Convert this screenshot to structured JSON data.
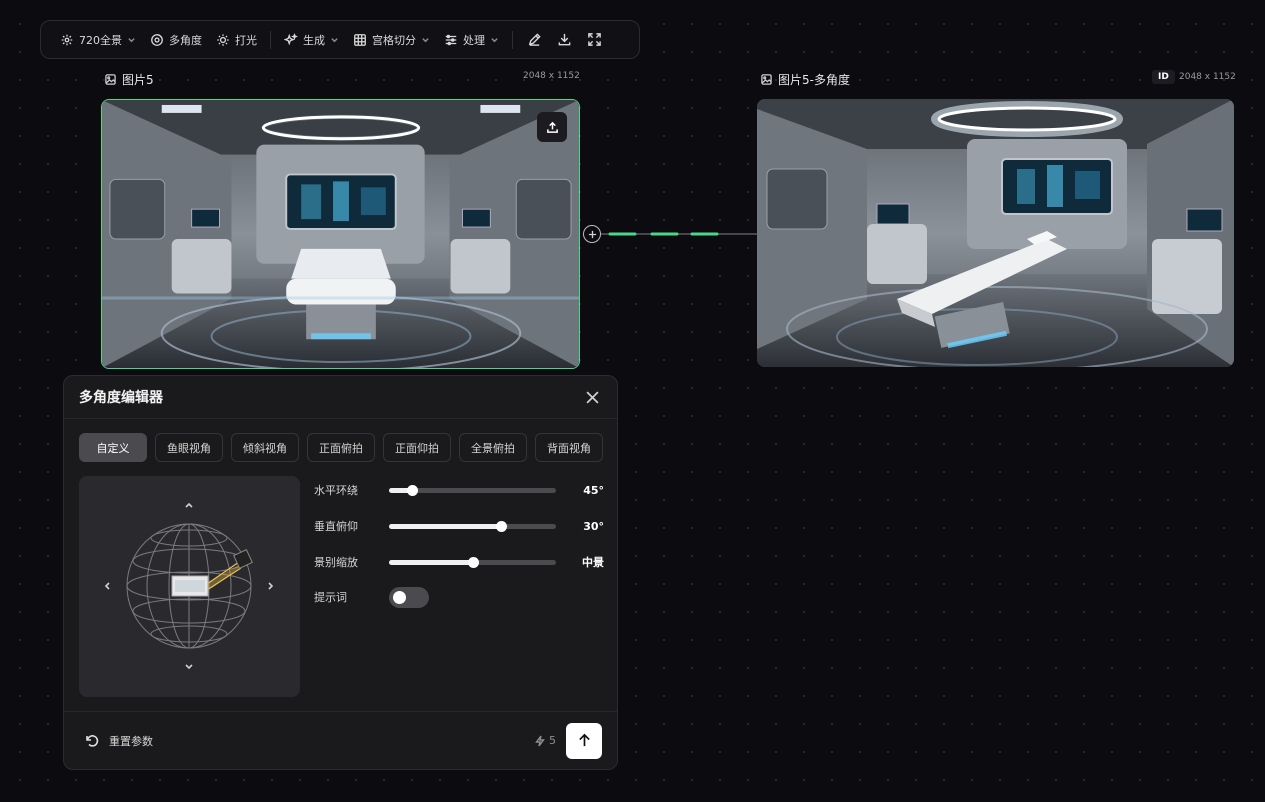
{
  "toolbar": {
    "panorama_label": "720全景",
    "multi_angle_label": "多角度",
    "lighting_label": "打光",
    "generate_label": "生成",
    "grid_split_label": "宫格切分",
    "process_label": "处理"
  },
  "left_card": {
    "title": "图片5",
    "dimensions": "2048 x 1152"
  },
  "right_card": {
    "title": "图片5-多角度",
    "id_badge": "ID",
    "dimensions": "2048 x 1152"
  },
  "panel": {
    "title": "多角度编辑器",
    "tabs": [
      {
        "label": "自定义"
      },
      {
        "label": "鱼眼视角"
      },
      {
        "label": "倾斜视角"
      },
      {
        "label": "正面俯拍"
      },
      {
        "label": "正面仰拍"
      },
      {
        "label": "全景俯拍"
      },
      {
        "label": "背面视角"
      }
    ],
    "controls": {
      "horizontal": {
        "label": "水平环绕",
        "value": "45°",
        "level": 0.14
      },
      "vertical": {
        "label": "垂直俯仰",
        "value": "30°",
        "level": 0.67
      },
      "zoom": {
        "label": "景别缩放",
        "value": "中景",
        "level": 0.5
      },
      "prompt": {
        "label": "提示词",
        "enabled": false
      }
    },
    "reset_label": "重置参数",
    "credits": "5"
  },
  "colors": {
    "accent_green": "#4cd68a",
    "background": "#0c0b0f",
    "panel": "#1a1a1c"
  }
}
